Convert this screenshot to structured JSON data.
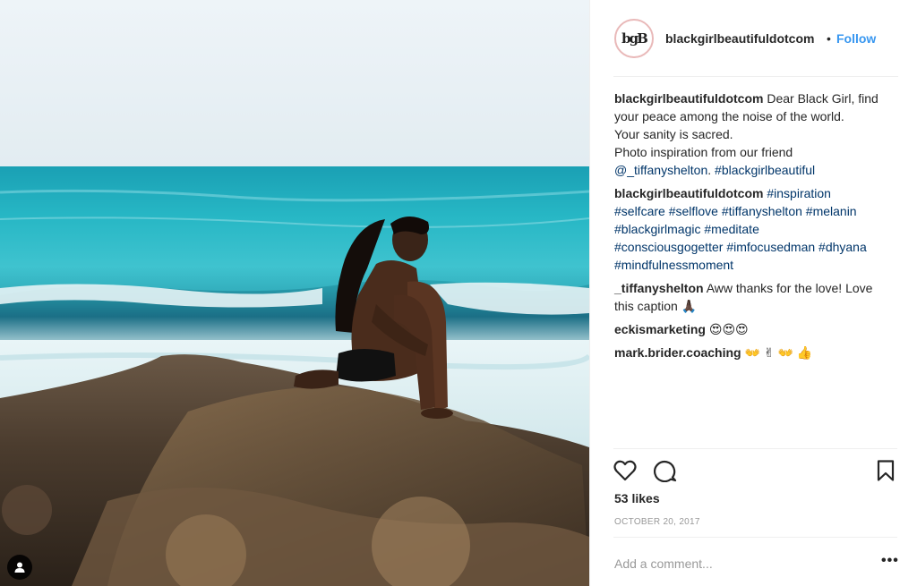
{
  "post": {
    "username": "blackgirlbeautifuldotcom",
    "avatar_text": "bgB",
    "separator": "•",
    "follow_label": "Follow",
    "likes": "53 likes",
    "date": "OCTOBER 20, 2017",
    "comment_placeholder": "Add a comment...",
    "more_label": "•••"
  },
  "comments": [
    {
      "user": "blackgirlbeautifuldotcom",
      "lines": [
        [
          {
            "t": "Dear Black Girl, find"
          }
        ],
        [
          {
            "t": "your peace among the noise of the world."
          }
        ],
        [
          {
            "t": "Your sanity is sacred."
          }
        ],
        [
          {
            "t": "Photo inspiration from our friend"
          }
        ],
        [
          {
            "t": "@_tiffanyshelton",
            "tag": true
          },
          {
            "t": ". "
          },
          {
            "t": "#blackgirlbeautiful",
            "tag": true
          }
        ]
      ]
    },
    {
      "user": "blackgirlbeautifuldotcom",
      "lines": [
        [
          {
            "t": "#inspiration",
            "tag": true
          }
        ],
        [
          {
            "t": "#selfcare",
            "tag": true
          },
          {
            "t": " "
          },
          {
            "t": "#selflove",
            "tag": true
          },
          {
            "t": " "
          },
          {
            "t": "#tiffanyshelton",
            "tag": true
          },
          {
            "t": " "
          },
          {
            "t": "#melanin",
            "tag": true
          }
        ],
        [
          {
            "t": "#blackgirlmagic",
            "tag": true
          },
          {
            "t": " "
          },
          {
            "t": "#meditate",
            "tag": true
          }
        ],
        [
          {
            "t": "#consciousgogetter",
            "tag": true
          },
          {
            "t": " "
          },
          {
            "t": "#imfocusedman",
            "tag": true
          },
          {
            "t": " "
          },
          {
            "t": "#dhyana",
            "tag": true
          }
        ],
        [
          {
            "t": "#mindfulnessmoment",
            "tag": true
          }
        ]
      ]
    },
    {
      "user": "_tiffanyshelton",
      "lines": [
        [
          {
            "t": "Aww thanks for the love! Love"
          }
        ],
        [
          {
            "t": "this caption 🙏🏿"
          }
        ]
      ]
    },
    {
      "user": "eckismarketing",
      "lines": [
        [
          {
            "t": "😍😍😍"
          }
        ]
      ]
    },
    {
      "user": "mark.brider.coaching",
      "lines": [
        [
          {
            "t": "👐 ✌ 👐 👍"
          }
        ]
      ]
    }
  ],
  "icons": {
    "like": "heart-icon",
    "comment": "comment-bubble-icon",
    "save": "bookmark-icon",
    "user_tag": "user-tag-icon"
  },
  "colors": {
    "link": "#3897f0",
    "hashtag": "#003569",
    "muted": "#999999",
    "text": "#262626",
    "avatar_ring": "#e9b9b9"
  }
}
